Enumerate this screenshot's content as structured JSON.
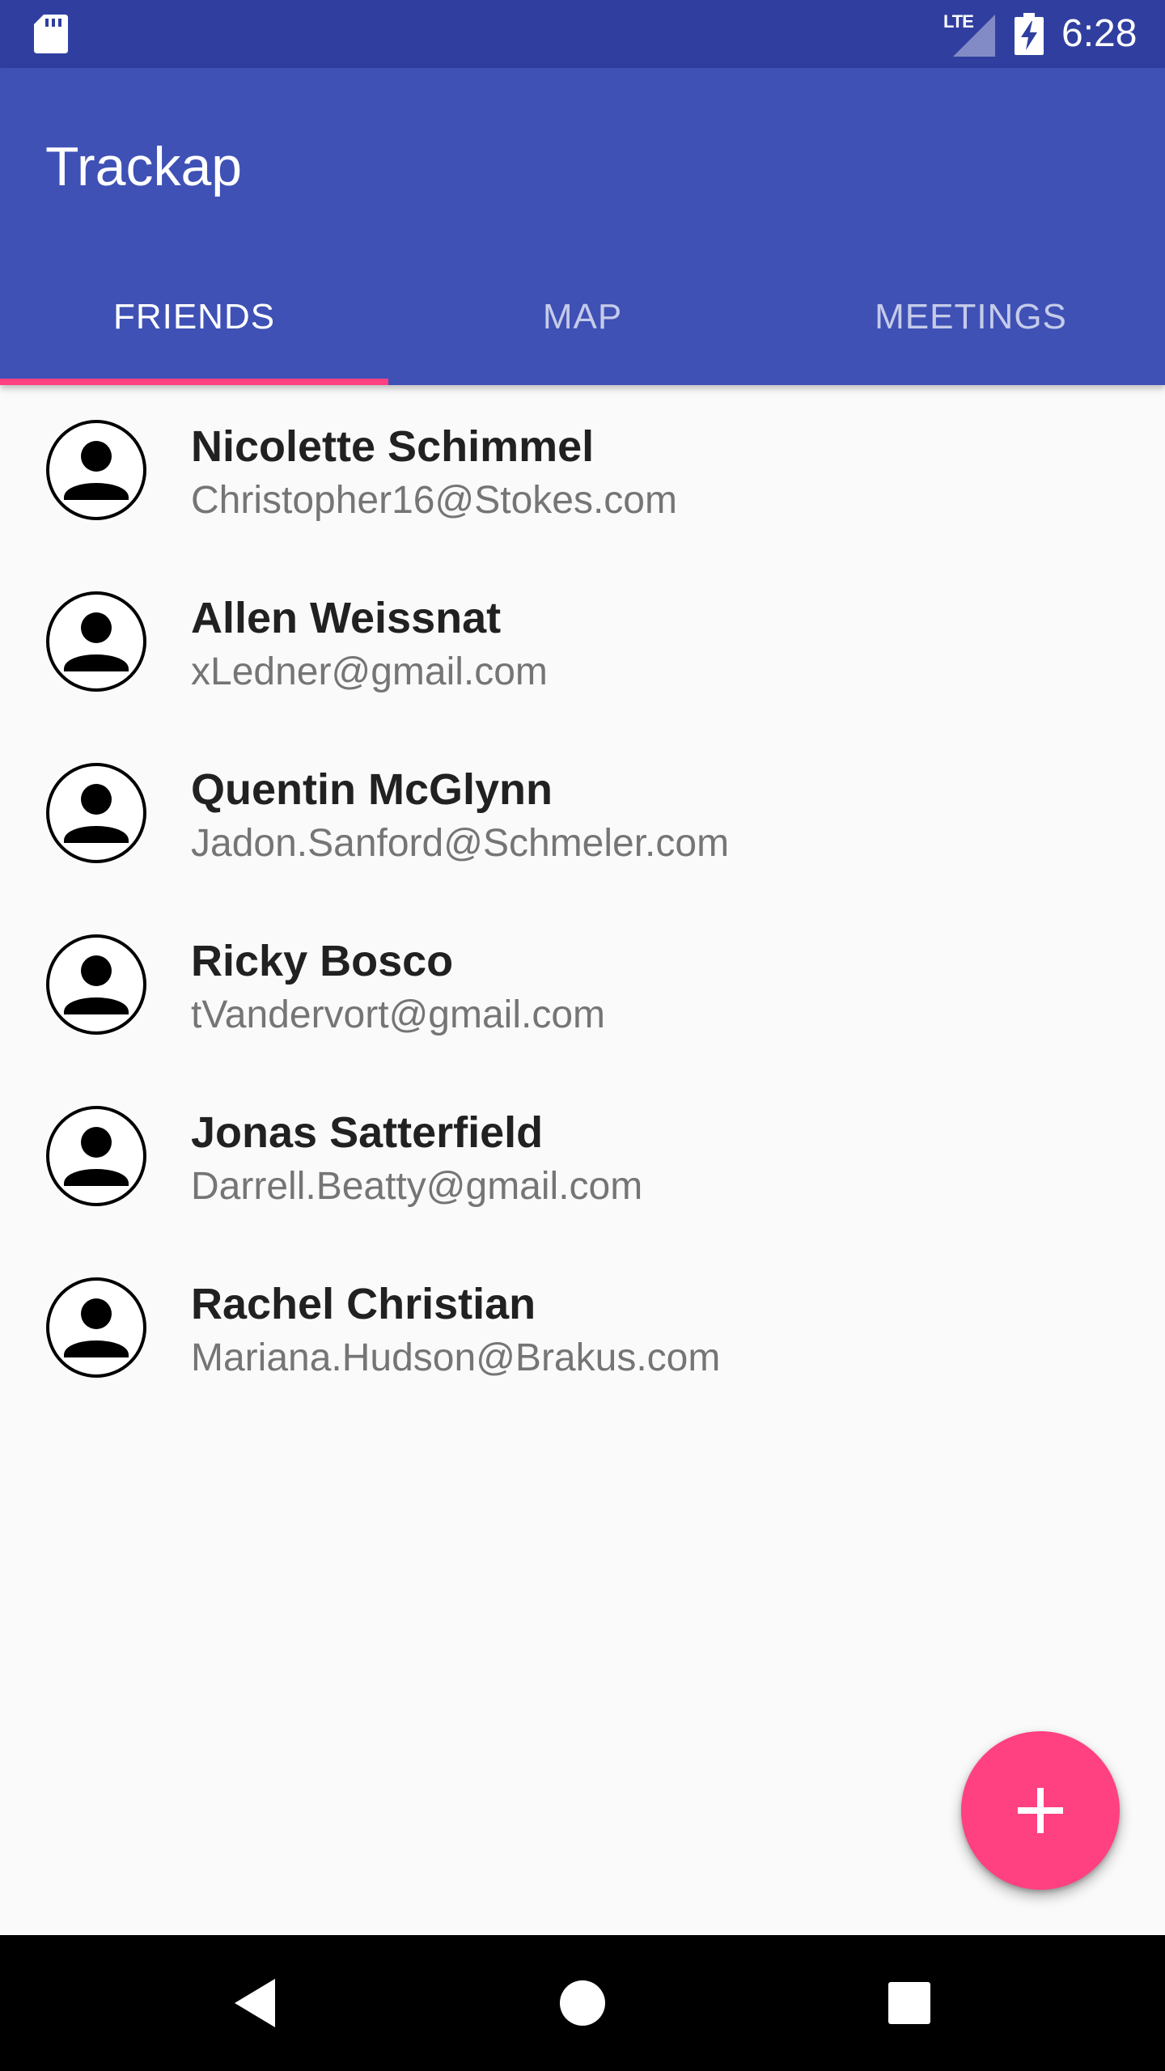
{
  "status_bar": {
    "time": "6:28",
    "network_label": "LTE",
    "icons": [
      "sd-card-icon",
      "lte-signal-icon",
      "battery-charging-icon"
    ]
  },
  "app_bar": {
    "title": "Trackap",
    "tabs": [
      {
        "label": "FRIENDS",
        "active": true
      },
      {
        "label": "MAP",
        "active": false
      },
      {
        "label": "MEETINGS",
        "active": false
      }
    ]
  },
  "friends": [
    {
      "name": "Nicolette Schimmel",
      "email": "Christopher16@Stokes.com",
      "icon": "person-avatar-icon"
    },
    {
      "name": "Allen Weissnat",
      "email": "xLedner@gmail.com",
      "icon": "person-avatar-icon"
    },
    {
      "name": "Quentin McGlynn",
      "email": "Jadon.Sanford@Schmeler.com",
      "icon": "person-avatar-icon"
    },
    {
      "name": "Ricky Bosco",
      "email": "tVandervort@gmail.com",
      "icon": "person-avatar-icon"
    },
    {
      "name": "Jonas Satterfield",
      "email": "Darrell.Beatty@gmail.com",
      "icon": "person-avatar-icon"
    },
    {
      "name": "Rachel Christian",
      "email": "Mariana.Hudson@Brakus.com",
      "icon": "person-avatar-icon"
    }
  ],
  "fab": {
    "icon": "plus-icon"
  },
  "nav_bar": {
    "icons": [
      "back-icon",
      "home-icon",
      "recents-icon"
    ]
  },
  "colors": {
    "primary": "#3F51B5",
    "primary_dark": "#303F9F",
    "accent": "#FF4081",
    "background": "#FAFAFA",
    "name_text": "#212121",
    "email_text": "#757575"
  }
}
